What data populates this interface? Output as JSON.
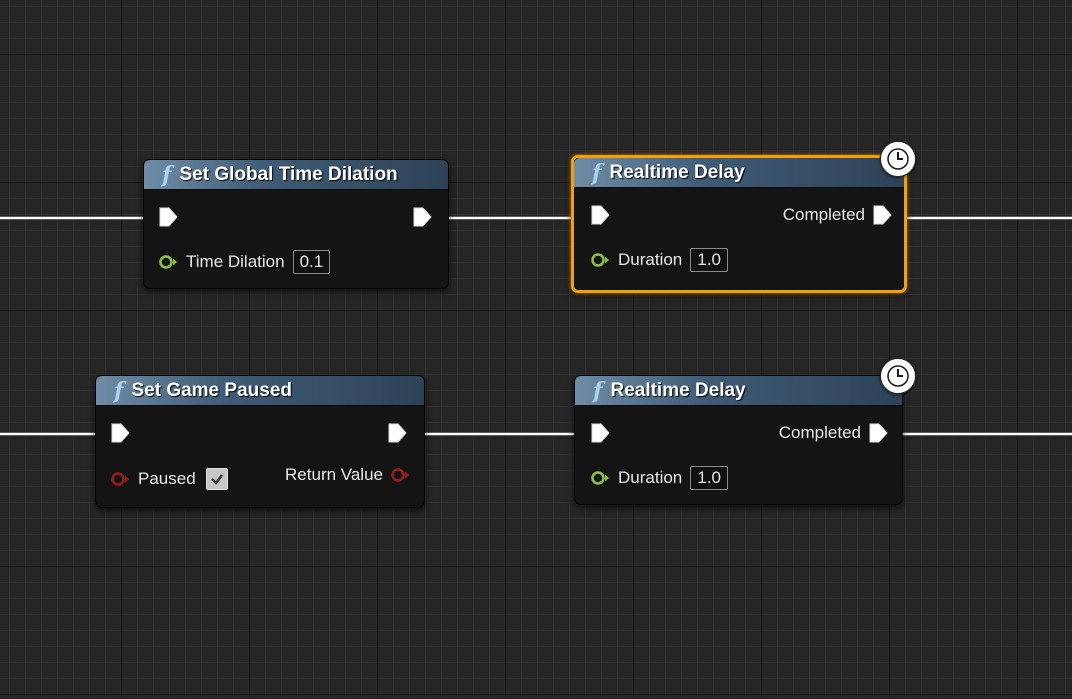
{
  "graph": {
    "nodes": [
      {
        "title": "Set Global Time Dilation",
        "icon": "function-icon",
        "selected": false,
        "inputs": [
          {
            "label": "Time Dilation",
            "value": "0.1",
            "pin_type": "float"
          }
        ]
      },
      {
        "title": "Realtime Delay",
        "icon": "function-icon",
        "selected": true,
        "latent": true,
        "outputs": [
          {
            "label": "Completed",
            "pin_type": "exec"
          }
        ],
        "inputs": [
          {
            "label": "Duration",
            "value": "1.0",
            "pin_type": "float"
          }
        ]
      },
      {
        "title": "Set Game Paused",
        "icon": "function-icon",
        "selected": false,
        "inputs": [
          {
            "label": "Paused",
            "checked": true,
            "pin_type": "bool"
          }
        ],
        "outputs": [
          {
            "label": "Return Value",
            "pin_type": "bool"
          }
        ]
      },
      {
        "title": "Realtime Delay",
        "icon": "function-icon",
        "selected": false,
        "latent": true,
        "outputs": [
          {
            "label": "Completed",
            "pin_type": "exec"
          }
        ],
        "inputs": [
          {
            "label": "Duration",
            "value": "1.0",
            "pin_type": "float"
          }
        ]
      }
    ]
  },
  "colors": {
    "background": "#262626",
    "node_header": "#3f5b76",
    "selection": "#f0a010",
    "float_pin": "#8bc34a",
    "bool_pin": "#9b1c1c",
    "exec_pin": "#ffffff",
    "wire": "#ffffff"
  }
}
